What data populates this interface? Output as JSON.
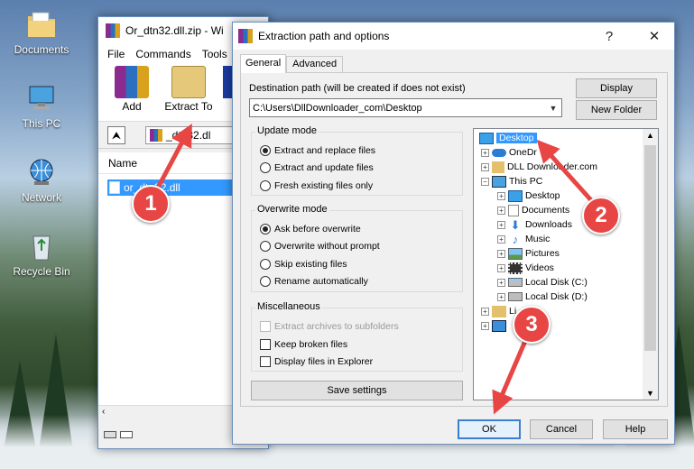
{
  "desktop": {
    "icons": [
      {
        "label": "Documents",
        "icon": "folder-documents-icon"
      },
      {
        "label": "This PC",
        "icon": "computer-icon"
      },
      {
        "label": "Network",
        "icon": "network-globe-icon"
      },
      {
        "label": "Recycle Bin",
        "icon": "recycle-bin-icon"
      }
    ]
  },
  "winrar": {
    "title": "Or_dtn32.dll.zip - Wi",
    "menu": [
      "File",
      "Commands",
      "Tools"
    ],
    "toolbar": {
      "add": "Add",
      "extract_to": "Extract To"
    },
    "path": "_dtn32.dl",
    "column_name": "Name",
    "file": "or_dtn32.dll"
  },
  "dialog": {
    "title": "Extraction path and options",
    "help": "?",
    "close": "✕",
    "tabs": [
      "General",
      "Advanced"
    ],
    "dest_label": "Destination path (will be created if does not exist)",
    "dest_value": "C:\\Users\\DllDownloader_com\\Desktop",
    "display_button": "Display",
    "new_folder_button": "New Folder",
    "update_mode": {
      "title": "Update mode",
      "options": [
        "Extract and replace files",
        "Extract and update files",
        "Fresh existing files only"
      ],
      "selected": 0
    },
    "overwrite_mode": {
      "title": "Overwrite mode",
      "options": [
        "Ask before overwrite",
        "Overwrite without prompt",
        "Skip existing files",
        "Rename automatically"
      ],
      "selected": 0
    },
    "misc": {
      "title": "Miscellaneous",
      "options": [
        "Extract archives to subfolders",
        "Keep broken files",
        "Display files in Explorer"
      ]
    },
    "save_settings": "Save settings",
    "tree": [
      "Desktop",
      "OneDr",
      "DLL Dow",
      "nloader.com",
      "This PC",
      "Desktop",
      "Documents",
      "Downloads",
      "Music",
      "Pictures",
      "Videos",
      "Local Disk (C:)",
      "Local Disk (D:)",
      "Li"
    ],
    "ok": "OK",
    "cancel": "Cancel",
    "help_button": "Help"
  },
  "callouts": [
    "1",
    "2",
    "3"
  ],
  "colors": {
    "accent": "#3c7fd1",
    "callout": "#e84545",
    "selection": "#3399ff"
  }
}
